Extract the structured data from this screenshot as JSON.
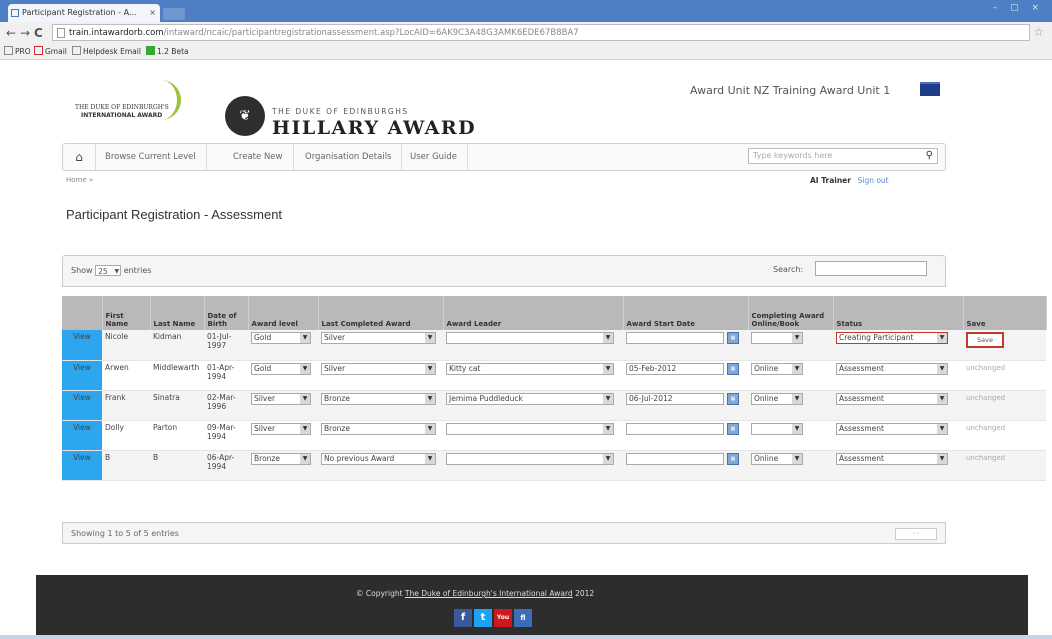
{
  "browser": {
    "tab_title": "Participant Registration - A...",
    "tab_close": "×",
    "window_controls": "– ▢ ×",
    "url_host": "train.intawardorb.com",
    "url_rest": "/intaward/ncaic/participantregistrationassessment.asp?LocAID=6AK9C3A48G3AMK6EDE67B8BA7",
    "bookmarks": [
      "PRO",
      "Gmail",
      "Helpdesk Email",
      "1.2 Beta"
    ],
    "back": "←",
    "forward": "→",
    "reload": "C",
    "star": "☆"
  },
  "header": {
    "ia_logo_line1": "THE DUKE OF EDINBURGH'S",
    "ia_logo_line2": "INTERNATIONAL AWARD",
    "ha_small": "THE DUKE OF EDINBURGHS",
    "ha_big": "HILLARY AWARD",
    "site_title": "Award Unit NZ Training Award Unit 1"
  },
  "nav": {
    "home_icon": "⌂",
    "items": [
      "Browse Current Level",
      "Create New",
      "Organisation Details",
      "User Guide"
    ],
    "search_placeholder": "Type keywords here",
    "search_icon": "🔍"
  },
  "breadcrumb": "Home »",
  "user": {
    "name": "AI Trainer",
    "signout": "Sign out"
  },
  "page_title": "Participant Registration - Assessment",
  "table_controls": {
    "show_label": "Show",
    "entries_value": "25",
    "entries_label": "entries",
    "search_label": "Search:"
  },
  "columns": [
    "",
    "First Name",
    "Last Name",
    "Date of Birth",
    "Award level",
    "Last Completed Award",
    "Award Leader",
    "Award Start Date",
    "Completing Award Online/Book",
    "Status",
    "Save"
  ],
  "rows": [
    {
      "edit": "View",
      "first": "Nicole",
      "last": "Kidman",
      "dob": "01-Jul-1997",
      "level": "Gold",
      "last_award": "Silver",
      "leader": "",
      "start": "",
      "online": "",
      "status": "Creating Participant",
      "save": "Save"
    },
    {
      "edit": "View",
      "first": "Arwen",
      "last": "Middlewarth",
      "dob": "01-Apr-1994",
      "level": "Gold",
      "last_award": "Silver",
      "leader": "Kitty cat",
      "start": "05-Feb-2012",
      "online": "Online",
      "status": "Assessment",
      "save": "unchanged"
    },
    {
      "edit": "View",
      "first": "Frank",
      "last": "Sinatra",
      "dob": "02-Mar-1996",
      "level": "Silver",
      "last_award": "Bronze",
      "leader": "Jemima Puddleduck",
      "start": "06-Jul-2012",
      "online": "Online",
      "status": "Assessment",
      "save": "unchanged"
    },
    {
      "edit": "View",
      "first": "Dolly",
      "last": "Parton",
      "dob": "09-Mar-1994",
      "level": "Silver",
      "last_award": "Bronze",
      "leader": "",
      "start": "",
      "online": "",
      "status": "Assessment",
      "save": "unchanged"
    },
    {
      "edit": "View",
      "first": "B",
      "last": "B",
      "dob": "06-Apr-1994",
      "level": "Bronze",
      "last_award": "No previous Award",
      "leader": "",
      "start": "",
      "online": "Online",
      "status": "Assessment",
      "save": "unchanged"
    }
  ],
  "table_info": "Showing 1 to 5 of 5 entries",
  "pager": "‹ ›",
  "footer": {
    "copy_prefix": "© Copyright",
    "copy_link": "The Duke of Edinburgh's International Award",
    "copy_year": "2012"
  },
  "social": [
    "f",
    "t",
    "You",
    "fl"
  ],
  "colors": {
    "tab_bar": "#4e7fc4",
    "edit_cell": "#2ca6ef",
    "header_bg": "#b9b9b9",
    "highlight": "#c0392b",
    "footer_bg": "#2d2d2d"
  }
}
